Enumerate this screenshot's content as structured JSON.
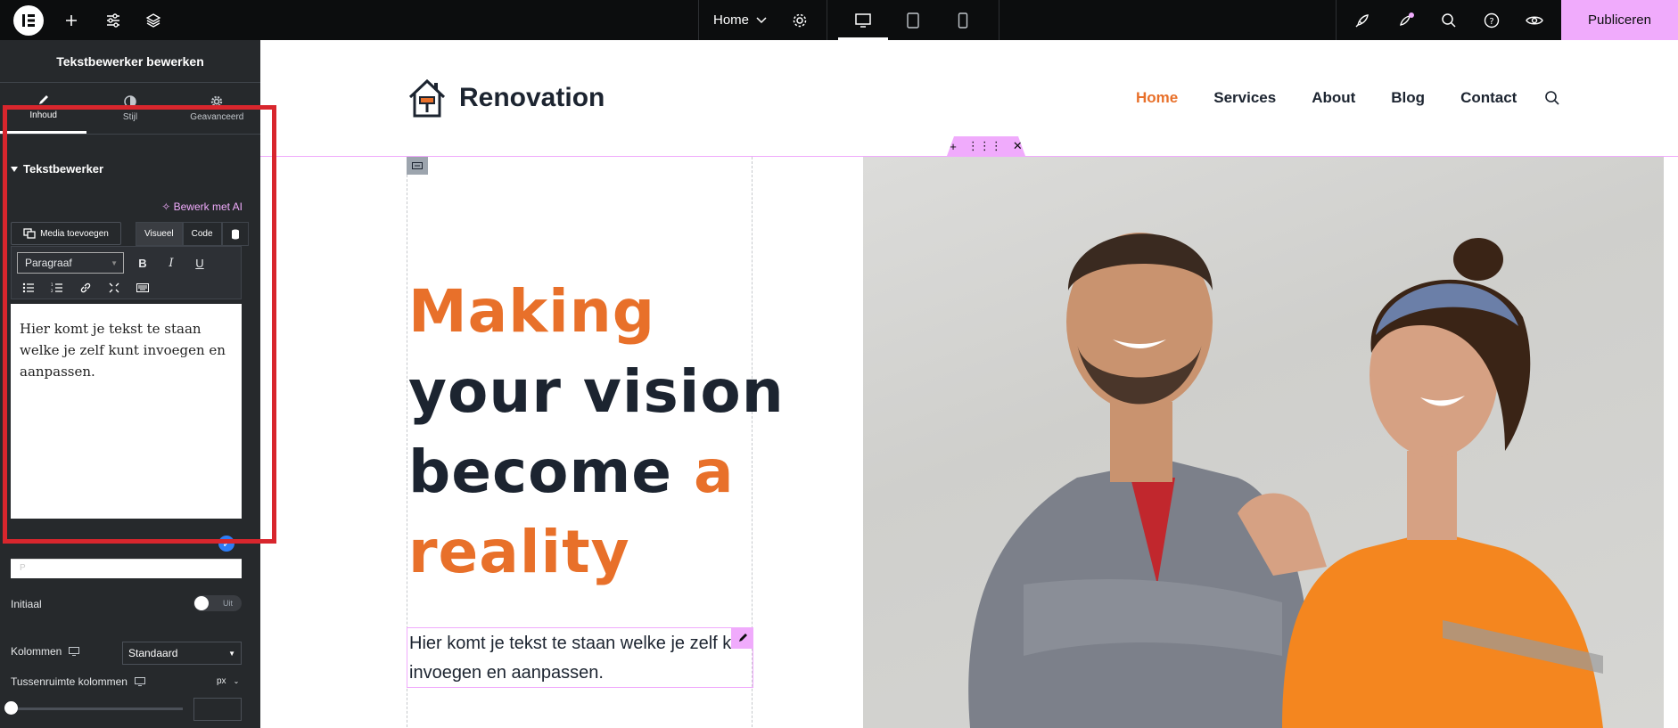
{
  "topbar": {
    "page_select": "Home",
    "publish_label": "Publiceren",
    "icons": [
      "elementor-logo-icon",
      "plus-icon",
      "sliders-icon",
      "layers-icon",
      "gear-icon",
      "desktop-icon",
      "tablet-icon",
      "mobile-icon",
      "rocket-icon",
      "notifications-icon",
      "search-icon",
      "help-icon",
      "eye-icon"
    ]
  },
  "panel": {
    "title": "Tekstbewerker bewerken",
    "tabs": [
      {
        "label": "Inhoud",
        "icon": "pencil-icon",
        "active": true
      },
      {
        "label": "Stijl",
        "icon": "contrast-icon",
        "active": false
      },
      {
        "label": "Geavanceerd",
        "icon": "gear-icon",
        "active": false
      }
    ],
    "section_title": "Tekstbewerker",
    "ai_link": "Bewerk met AI",
    "media_button": "Media toevoegen",
    "mode_tabs": [
      "Visueel",
      "Code"
    ],
    "paragraph_select": "Paragraaf",
    "format_buttons": [
      "B",
      "I",
      "U"
    ],
    "editor_text": "Hier komt je tekst te staan welke je zelf kunt invoegen en aanpassen.",
    "editor_footer": "P",
    "controls": {
      "initial_label": "Initiaal",
      "initial_toggle": "Uit",
      "columns_label": "Kolommen",
      "columns_value": "Standaard",
      "gap_label": "Tussenruimte kolommen",
      "gap_unit": "px",
      "gap_slider_value": 0
    },
    "highlight_color": "#d8262d"
  },
  "site": {
    "name": "Renovation",
    "nav": [
      "Home",
      "Services",
      "About",
      "Blog",
      "Contact"
    ],
    "active_nav": "Home",
    "hero": {
      "line1": "Making",
      "line2": "your vision",
      "line3_a": "become ",
      "line3_b": "a",
      "line4": "reality"
    },
    "body_text": "Hier komt je tekst te staan welke je zelf kunt invoegen en aanpassen.",
    "accent_color": "#e8702a",
    "text_color": "#1c2430"
  }
}
